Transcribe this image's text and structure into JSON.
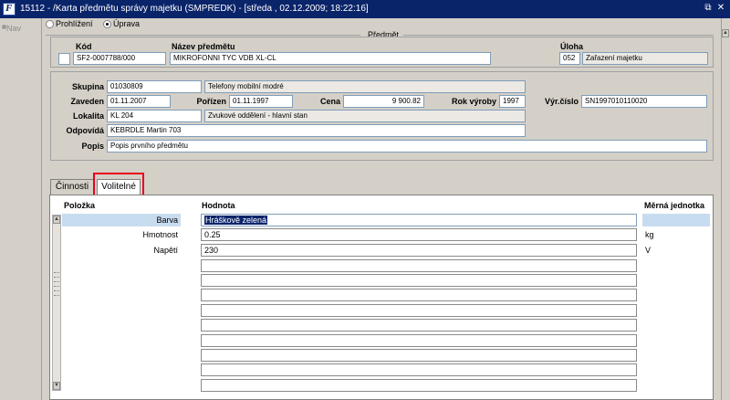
{
  "window": {
    "title": "15112 - /Karta předmětu správy majetku (SMPREDK) - [středa , 02.12.2009; 18:22:16]",
    "restore_icon": "restore-icon",
    "close_icon": "close-icon"
  },
  "nav": {
    "label": "Nav"
  },
  "mode": {
    "options": [
      {
        "label": "Prohlížení",
        "selected": false
      },
      {
        "label": "Úprava",
        "selected": true
      }
    ]
  },
  "predmet": {
    "group_label": "Předmět",
    "kod_label": "Kód",
    "kod_value": "SF2-0007788/000",
    "nazev_label": "Název předmětu",
    "nazev_value": "MIKROFONNI TYC VDB XL-CL",
    "uloha_label": "Úloha",
    "uloha_code": "052",
    "uloha_name": "Zařazení majetku"
  },
  "detail": {
    "skupina_label": "Skupina",
    "skupina_code": "01030809",
    "skupina_name": "Telefony mobilní modré",
    "zaveden_label": "Zaveden",
    "zaveden_value": "01.11.2007",
    "porizen_label": "Pořízen",
    "porizen_value": "01.11.1997",
    "cena_label": "Cena",
    "cena_value": "9 900.82",
    "rok_label": "Rok výroby",
    "rok_value": "1997",
    "vyrcislo_label": "Výr.číslo",
    "vyrcislo_value": "SN1997010110020",
    "lokalita_label": "Lokalita",
    "lokalita_code": "KL 204",
    "lokalita_name": "Zvukové oddělení - hlavní stan",
    "odpovida_label": "Odpovídá",
    "odpovida_value": "KEBRDLE Martin 703",
    "popis_label": "Popis",
    "popis_value": "Popis prvního předmětu"
  },
  "tabs": [
    {
      "label": "Činnosti",
      "active": false
    },
    {
      "label": "Volitelné",
      "active": true
    }
  ],
  "grid": {
    "headers": {
      "polozka": "Položka",
      "hodnota": "Hodnota",
      "jednotka": "Měrná jednotka"
    },
    "rows": [
      {
        "polozka": "Barva",
        "hodnota": "Hráškově zelená",
        "jednotka": ""
      },
      {
        "polozka": "Hmotnost",
        "hodnota": "0.25",
        "jednotka": "kg"
      },
      {
        "polozka": "Napětí",
        "hodnota": "230",
        "jednotka": "V"
      }
    ]
  },
  "colors": {
    "title_bar": "#0a246a",
    "highlight": "#e8001a",
    "selection": "#0a246a"
  }
}
